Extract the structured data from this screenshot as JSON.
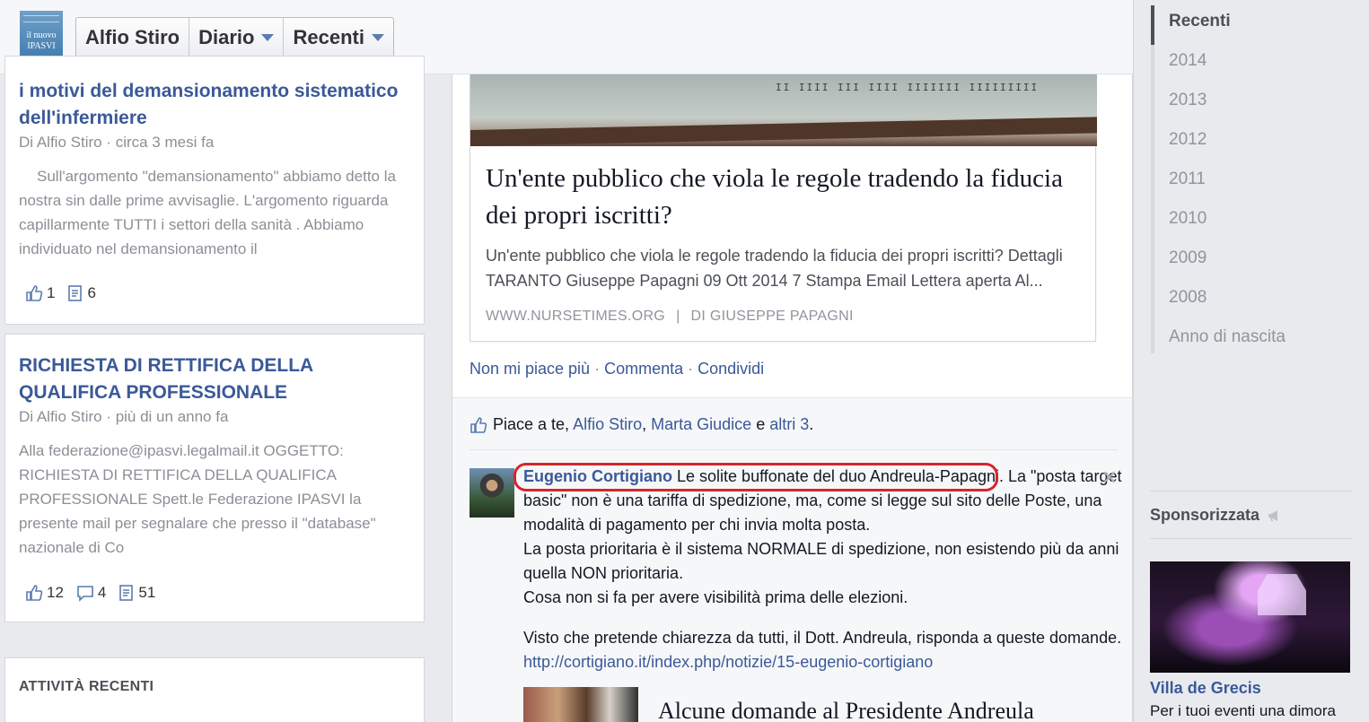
{
  "header": {
    "logo": {
      "line1": "il nuovo",
      "line2": "IPASVI"
    },
    "nav": [
      {
        "label": "Alfio Stiro",
        "dropdown": false
      },
      {
        "label": "Diario",
        "dropdown": true
      },
      {
        "label": "Recenti",
        "dropdown": true
      }
    ]
  },
  "left": {
    "card1": {
      "title": "i motivi del demansionamento sistematico dell'infermiere",
      "meta": "Di Alfio Stiro · circa 3 mesi fa",
      "text": "Sull'argomento \"demansionamento\" abbiamo detto la nostra sin dalle prime avvisaglie. L'argomento riguarda capillarmente TUTTI i settori della sanità  . Abbiamo individuato nel demansionamento il",
      "likes": "1",
      "views": "6"
    },
    "card2": {
      "title": "RICHIESTA DI RETTIFICA DELLA QUALIFICA PROFESSIONALE",
      "meta": "Di Alfio Stiro · più di un anno fa",
      "text": "Alla federazione@ipasvi.legalmail.it OGGETTO: RICHIESTA DI RETTIFICA DELLA QUALIFICA PROFESSIONALE Spett.le Federazione IPASVI la presente mail per segnalare che presso il \"database\" nazionale di Co",
      "likes": "12",
      "comments": "4",
      "views": "51"
    },
    "activity_title": "ATTIVITÀ RECENTI"
  },
  "post": {
    "image_marks": "II IIII III IIII  IIIIIII  IIIIIIIII",
    "link_title": "Un'ente pubblico che viola le regole tradendo la fiducia dei propri iscritti?",
    "link_desc": "Un'ente pubblico che viola le regole tradendo la fiducia dei propri iscritti? Dettagli TARANTO Giuseppe Papagni 09 Ott 2014 7 Stampa Email Lettera aperta Al...",
    "source_site": "WWW.NURSETIMES.ORG",
    "source_sep": "|",
    "source_author": "DI GIUSEPPE PAPAGNI",
    "actions": {
      "unlike": "Non mi piace più",
      "comment": "Commenta",
      "share": "Condividi",
      "dot": "·"
    }
  },
  "feedback": {
    "likes": {
      "prefix": "Piace a te,",
      "name1": "Alfio Stiro",
      "comma": ",",
      "name2": "Marta Giudice",
      "and": "e",
      "others": "altri 3",
      "period": "."
    },
    "comment": {
      "author": "Eugenio Cortigiano",
      "line1_highlight": "Le solite buffonate del duo Andreula-Papagni.",
      "line1_rest": "La \"posta target basic\" non è una tariffa di spedizione, ma, come si legge sul sito delle Poste, una modalità di pagamento per chi invia molta posta.",
      "line2": "La posta prioritaria è il sistema NORMALE di spedizione, non esistendo più da anni quella NON prioritaria.",
      "line3": "Cosa non si fa per avere visibilità prima delle elezioni.",
      "line4": "Visto che pretende chiarezza da tutti, il Dott. Andreula, risponda a queste domande.",
      "link": "http://cortigiano.it/index.php/notizie/15-eugenio-cortigiano",
      "close": "✕",
      "preview_title": "Alcune domande al Presidente Andreula"
    }
  },
  "timeline": [
    {
      "label": "Recenti",
      "active": true
    },
    {
      "label": "2014"
    },
    {
      "label": "2013"
    },
    {
      "label": "2012"
    },
    {
      "label": "2011"
    },
    {
      "label": "2010"
    },
    {
      "label": "2009"
    },
    {
      "label": "2008"
    },
    {
      "label": "Anno di nascita"
    }
  ],
  "sponsored": {
    "title": "Sponsorizzata",
    "ad_title": "Villa de Grecis",
    "ad_text": "Per i tuoi eventi una dimora"
  },
  "colors": {
    "link_blue": "#3b5998",
    "highlight_red": "#d6262b",
    "background": "#e9eaed"
  }
}
